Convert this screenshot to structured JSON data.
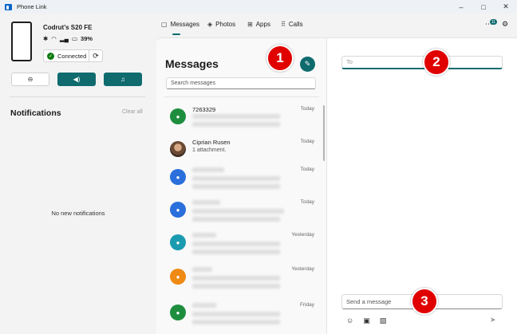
{
  "window": {
    "title": "Phone Link",
    "controls": [
      "–",
      "□",
      "✕"
    ]
  },
  "device": {
    "name": "Codrut's S20 FE",
    "battery": "39%",
    "connection_status": "Connected"
  },
  "quick_actions": [
    {
      "icon": "do-not-disturb-icon",
      "glyph": "⊖",
      "state": "off"
    },
    {
      "icon": "volume-icon",
      "glyph": "🔊",
      "state": "on"
    },
    {
      "icon": "music-icon",
      "glyph": "♫",
      "state": "on"
    }
  ],
  "notifications": {
    "title": "Notifications",
    "clear_all": "Clear all",
    "empty_text": "No new notifications"
  },
  "nav": {
    "tabs": [
      {
        "label": "Messages",
        "icon": "messages-icon",
        "glyph": "💬"
      },
      {
        "label": "Photos",
        "icon": "photos-icon",
        "glyph": "🖼"
      },
      {
        "label": "Apps",
        "icon": "apps-icon",
        "glyph": "⊞"
      },
      {
        "label": "Calls",
        "icon": "calls-icon",
        "glyph": "⠿"
      }
    ],
    "active_tab": "Messages",
    "notification_badge": "11"
  },
  "messages": {
    "title": "Messages",
    "search_placeholder": "Search messages",
    "threads": [
      {
        "name": "7263329",
        "preview": "",
        "date": "Today",
        "avatar_color": "#1e8e3e"
      },
      {
        "name": "Ciprian Rusen",
        "preview": "1 attachment.",
        "date": "Today",
        "avatar_color": "photo"
      },
      {
        "name": "",
        "preview": "",
        "date": "Today",
        "avatar_color": "#2a6fdb"
      },
      {
        "name": "",
        "preview": "",
        "date": "Today",
        "avatar_color": "#2a6fdb"
      },
      {
        "name": "",
        "preview": "",
        "date": "Yesterday",
        "avatar_color": "#1a9bb0"
      },
      {
        "name": "",
        "preview": "",
        "date": "Yesterday",
        "avatar_color": "#ef8a14"
      },
      {
        "name": "",
        "preview": "",
        "date": "Friday",
        "avatar_color": "#1e8e3e"
      }
    ]
  },
  "conversation": {
    "to_placeholder": "To",
    "compose_placeholder": "Send a message"
  },
  "callouts": [
    "1",
    "2",
    "3"
  ]
}
